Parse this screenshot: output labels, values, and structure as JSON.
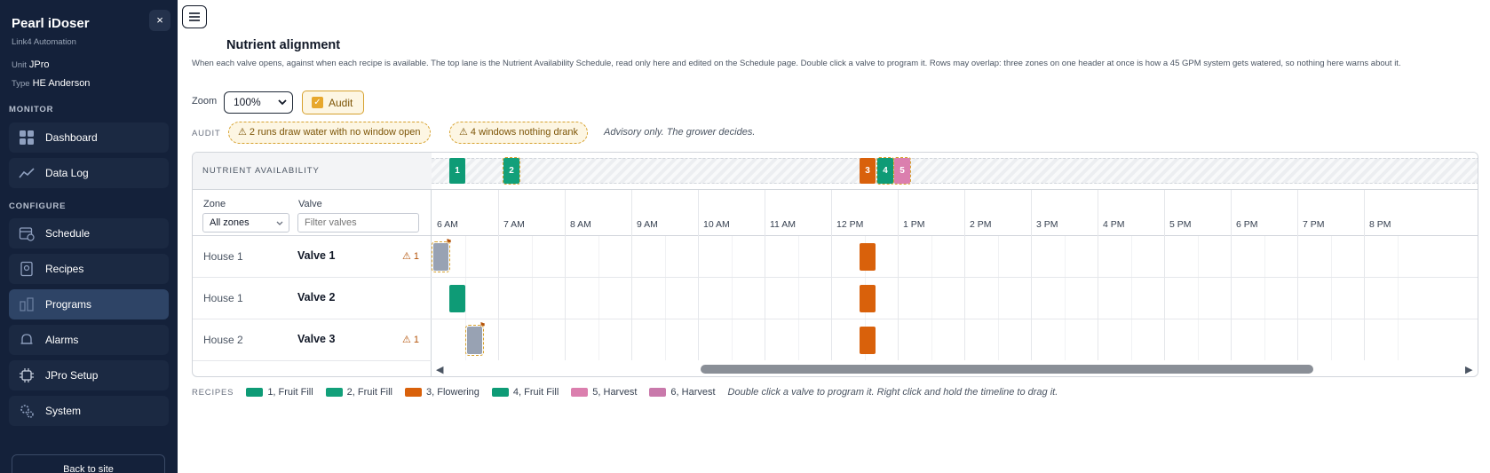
{
  "sidebar": {
    "brand": "Pearl iDoser",
    "brand_sub": "Link4 Automation",
    "close_glyph": "×",
    "unit_key": "Unit",
    "unit_value": "JPro",
    "type_key": "Type",
    "type_value": "HE Anderson",
    "section_monitor": "MONITOR",
    "section_configure": "CONFIGURE",
    "items": [
      {
        "label": "Dashboard",
        "icon": "dashboard-icon"
      },
      {
        "label": "Data Log",
        "icon": "chart-line-icon"
      },
      {
        "label": "Schedule",
        "icon": "calendar-clock-icon"
      },
      {
        "label": "Recipes",
        "icon": "recipe-icon"
      },
      {
        "label": "Programs",
        "icon": "programs-icon",
        "active": true
      },
      {
        "label": "Alarms",
        "icon": "bell-icon"
      },
      {
        "label": "JPro Setup",
        "icon": "chip-icon"
      },
      {
        "label": "System",
        "icon": "gears-icon"
      }
    ],
    "back_label": "Back to site"
  },
  "main": {
    "title": "Nutrient alignment",
    "description": "When each valve opens, against when each recipe is available. The top lane is the Nutrient Availability Schedule, read only here and edited on the Schedule page. Double click a valve to program it. Rows may overlap: three zones on one header at once is how a 45 GPM system gets watered, so nothing here warns about it.",
    "zoom_label": "Zoom",
    "zoom_value": "100%",
    "audit_toggle_label": "Audit",
    "audit_checked": true,
    "audit_section_label": "AUDIT",
    "audit_pills": [
      "⚠ 2 runs draw water with no window open",
      "⚠ 4 windows nothing drank"
    ],
    "advisory": "Advisory only. The grower decides."
  },
  "timeline": {
    "nutrient_lane_label": "NUTRIENT AVAILABILITY",
    "zone_col_label": "Zone",
    "valve_col_label": "Valve",
    "zone_filter_value": "All zones",
    "valve_filter_placeholder": "Filter valves",
    "hours": [
      "6 AM",
      "7 AM",
      "8 AM",
      "9 AM",
      "10 AM",
      "11 AM",
      "12 PM",
      "1 PM",
      "2 PM",
      "3 PM",
      "4 PM",
      "5 PM",
      "6 PM",
      "7 PM",
      "8 PM"
    ],
    "availability_windows": [
      {
        "recipe": "1",
        "label": "1"
      },
      {
        "recipe": "2",
        "label": "2"
      },
      {
        "recipe": "3",
        "label": "3"
      },
      {
        "recipe": "4",
        "label": "4"
      },
      {
        "recipe": "5",
        "label": "5"
      }
    ],
    "rows": [
      {
        "zone": "House 1",
        "valve": "Valve 1",
        "warning": "⚠ 1"
      },
      {
        "zone": "House 1",
        "valve": "Valve 2",
        "warning": ""
      },
      {
        "zone": "House 2",
        "valve": "Valve 3",
        "warning": "⚠ 1"
      }
    ],
    "scroll_left": "◀",
    "scroll_right": "▶",
    "flag_glyph": "⚑"
  },
  "legend": {
    "title": "RECIPES",
    "items": [
      {
        "label": "1, Fruit Fill",
        "color": "#0e9b76"
      },
      {
        "label": "2, Fruit Fill",
        "color": "#12a07a"
      },
      {
        "label": "3, Flowering",
        "color": "#d9610b"
      },
      {
        "label": "4, Fruit Fill",
        "color": "#0e9b76"
      },
      {
        "label": "5, Harvest",
        "color": "#db7fae"
      },
      {
        "label": "6, Harvest",
        "color": "#c979ab"
      }
    ],
    "hint": "Double click a valve to program it. Right click and hold the timeline to drag it."
  },
  "colors": {
    "sidebar_bg": "#14213a",
    "active_nav": "#2e4466",
    "green": "#0e9b76",
    "orange": "#d9610b",
    "pink": "#db7fae",
    "run_grey": "#98a2b3",
    "audit_amber": "#d6a12e"
  }
}
